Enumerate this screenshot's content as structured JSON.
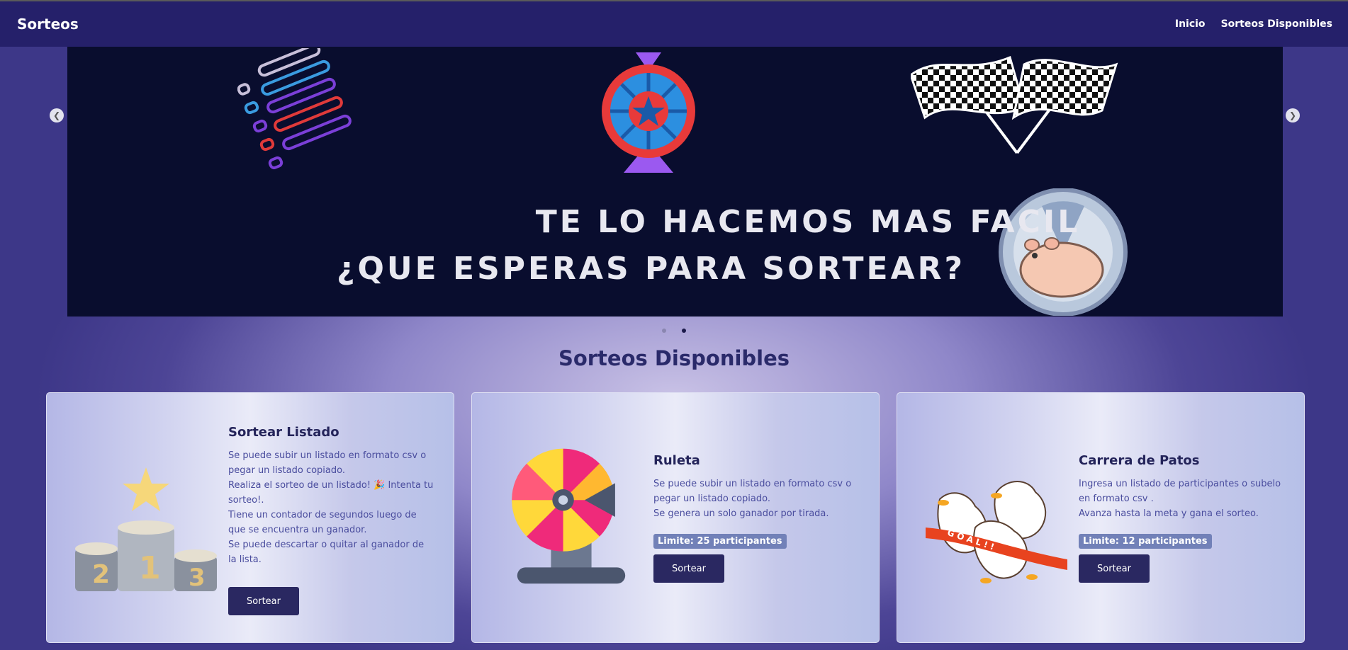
{
  "navbar": {
    "brand": "Sorteos",
    "links": [
      "Inicio",
      "Sorteos Disponibles"
    ]
  },
  "carousel": {
    "line1": "TE LO HACEMOS MAS FACIL",
    "line2": "¿QUE ESPERAS PARA SORTEAR?",
    "prev_icon": "chevron-left-icon",
    "next_icon": "chevron-right-icon",
    "slide_count": 2,
    "active_slide": 2
  },
  "section_title": "Sorteos Disponibles",
  "cards": [
    {
      "title": "Sortear Listado",
      "lines": [
        "Se puede subir un listado en formato csv o pegar un listado copiado.",
        "Realiza el sorteo de un listado! 🎉 Intenta tu sorteo!.",
        "Tiene un contador de segundos luego de que se encuentra un ganador.",
        "Se puede descartar o quitar al ganador de la lista."
      ],
      "button": "Sortear"
    },
    {
      "title": "Ruleta",
      "lines": [
        "Se puede subir un listado en formato csv o pegar un listado copiado.",
        "Se genera un solo ganador por tirada."
      ],
      "badge": "Limite: 25 participantes",
      "button": "Sortear"
    },
    {
      "title": "Carrera de Patos",
      "lines": [
        "Ingresa un listado de participantes o subelo en formato csv .",
        "Avanza hasta la meta y gana el sorteo."
      ],
      "badge": "Limite: 12 participantes",
      "button": "Sortear"
    }
  ],
  "colors": {
    "navbar": "#25206a",
    "button": "#2a2861",
    "badge": "#7281b8"
  }
}
